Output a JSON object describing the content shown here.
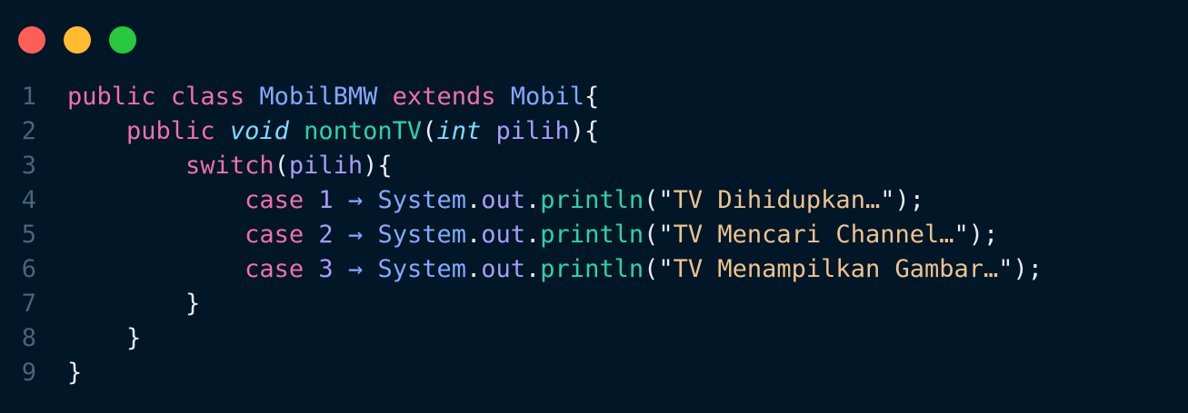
{
  "window": {
    "buttons": [
      {
        "name": "close",
        "color": "#ff5f57"
      },
      {
        "name": "minimize",
        "color": "#febc2e"
      },
      {
        "name": "maximize",
        "color": "#28c840"
      }
    ]
  },
  "code": {
    "language": "java",
    "lines": [
      {
        "number": "1",
        "indent": "",
        "tokens": [
          {
            "t": "public",
            "c": "kw"
          },
          {
            "t": " ",
            "c": "pu"
          },
          {
            "t": "class",
            "c": "kw"
          },
          {
            "t": " ",
            "c": "pu"
          },
          {
            "t": "MobilBMW",
            "c": "ty"
          },
          {
            "t": " ",
            "c": "pu"
          },
          {
            "t": "extends",
            "c": "kw"
          },
          {
            "t": " ",
            "c": "pu"
          },
          {
            "t": "Mobil",
            "c": "ty"
          },
          {
            "t": "{",
            "c": "pu"
          }
        ]
      },
      {
        "number": "2",
        "indent": "    ",
        "tokens": [
          {
            "t": "public",
            "c": "kw"
          },
          {
            "t": " ",
            "c": "pu"
          },
          {
            "t": "void",
            "c": "it"
          },
          {
            "t": " ",
            "c": "pu"
          },
          {
            "t": "nontonTV",
            "c": "fn"
          },
          {
            "t": "(",
            "c": "pu"
          },
          {
            "t": "int",
            "c": "it"
          },
          {
            "t": " ",
            "c": "pu"
          },
          {
            "t": "pilih",
            "c": "vr"
          },
          {
            "t": "){",
            "c": "pu"
          }
        ]
      },
      {
        "number": "3",
        "indent": "        ",
        "tokens": [
          {
            "t": "switch",
            "c": "kw"
          },
          {
            "t": "(",
            "c": "pu"
          },
          {
            "t": "pilih",
            "c": "vr"
          },
          {
            "t": "){",
            "c": "pu"
          }
        ]
      },
      {
        "number": "4",
        "indent": "            ",
        "tokens": [
          {
            "t": "case",
            "c": "kw"
          },
          {
            "t": " ",
            "c": "pu"
          },
          {
            "t": "1",
            "c": "num"
          },
          {
            "t": " ",
            "c": "pu"
          },
          {
            "t": "→",
            "c": "op"
          },
          {
            "t": " ",
            "c": "pu"
          },
          {
            "t": "System",
            "c": "ty"
          },
          {
            "t": ".",
            "c": "pu"
          },
          {
            "t": "out",
            "c": "vr"
          },
          {
            "t": ".",
            "c": "pu"
          },
          {
            "t": "println",
            "c": "fn"
          },
          {
            "t": "(",
            "c": "pu"
          },
          {
            "t": "\"",
            "c": "pu"
          },
          {
            "t": "TV Dihidupkan…",
            "c": "st"
          },
          {
            "t": "\"",
            "c": "pu"
          },
          {
            "t": ");",
            "c": "pu"
          }
        ]
      },
      {
        "number": "5",
        "indent": "            ",
        "tokens": [
          {
            "t": "case",
            "c": "kw"
          },
          {
            "t": " ",
            "c": "pu"
          },
          {
            "t": "2",
            "c": "num"
          },
          {
            "t": " ",
            "c": "pu"
          },
          {
            "t": "→",
            "c": "op"
          },
          {
            "t": " ",
            "c": "pu"
          },
          {
            "t": "System",
            "c": "ty"
          },
          {
            "t": ".",
            "c": "pu"
          },
          {
            "t": "out",
            "c": "vr"
          },
          {
            "t": ".",
            "c": "pu"
          },
          {
            "t": "println",
            "c": "fn"
          },
          {
            "t": "(",
            "c": "pu"
          },
          {
            "t": "\"",
            "c": "pu"
          },
          {
            "t": "TV Mencari Channel…",
            "c": "st"
          },
          {
            "t": "\"",
            "c": "pu"
          },
          {
            "t": ");",
            "c": "pu"
          }
        ]
      },
      {
        "number": "6",
        "indent": "            ",
        "tokens": [
          {
            "t": "case",
            "c": "kw"
          },
          {
            "t": " ",
            "c": "pu"
          },
          {
            "t": "3",
            "c": "num"
          },
          {
            "t": " ",
            "c": "pu"
          },
          {
            "t": "→",
            "c": "op"
          },
          {
            "t": " ",
            "c": "pu"
          },
          {
            "t": "System",
            "c": "ty"
          },
          {
            "t": ".",
            "c": "pu"
          },
          {
            "t": "out",
            "c": "vr"
          },
          {
            "t": ".",
            "c": "pu"
          },
          {
            "t": "println",
            "c": "fn"
          },
          {
            "t": "(",
            "c": "pu"
          },
          {
            "t": "\"",
            "c": "pu"
          },
          {
            "t": "TV Menampilkan Gambar…",
            "c": "st"
          },
          {
            "t": "\"",
            "c": "pu"
          },
          {
            "t": ");",
            "c": "pu"
          }
        ]
      },
      {
        "number": "7",
        "indent": "        ",
        "tokens": [
          {
            "t": "}",
            "c": "pu"
          }
        ]
      },
      {
        "number": "8",
        "indent": "    ",
        "tokens": [
          {
            "t": "}",
            "c": "pu"
          }
        ]
      },
      {
        "number": "9",
        "indent": "",
        "tokens": [
          {
            "t": "}",
            "c": "pu"
          }
        ]
      }
    ]
  }
}
